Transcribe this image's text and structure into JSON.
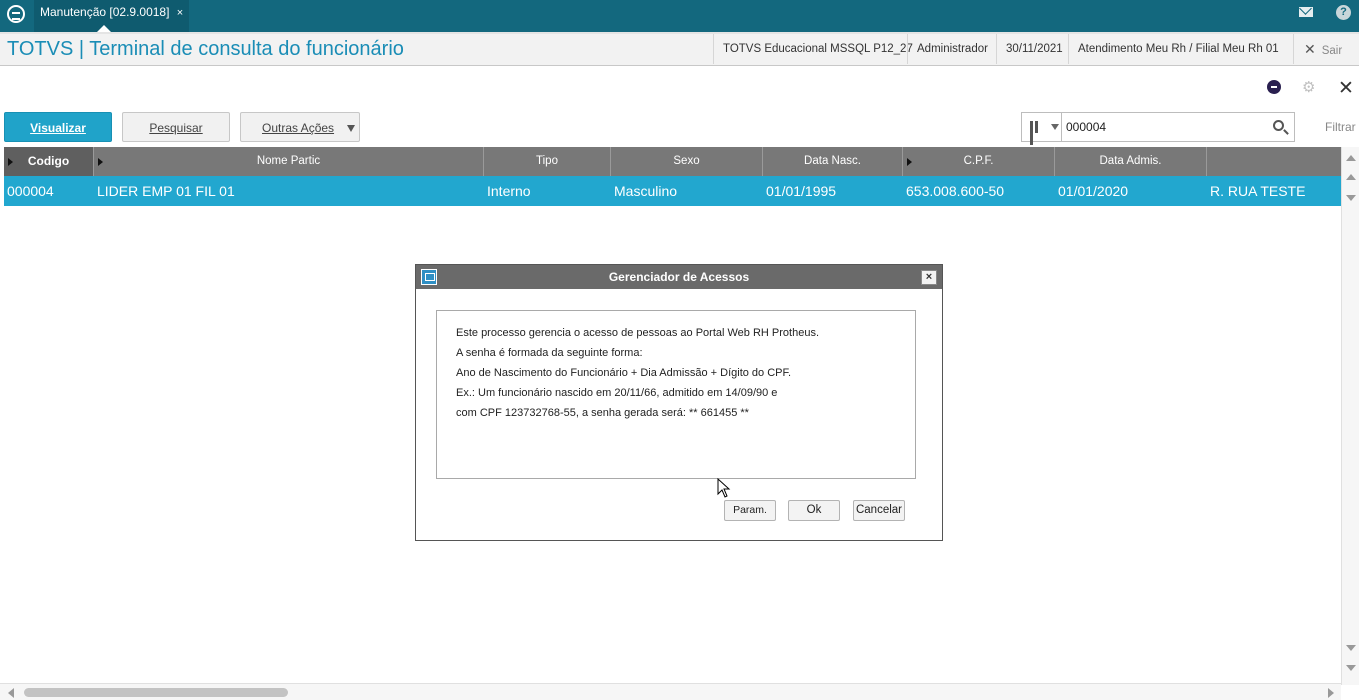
{
  "topbar": {
    "tab_label": "Manutenção [02.9.0018]",
    "tab_close": "×",
    "help": "?"
  },
  "header": {
    "title": "TOTVS | Terminal de consulta do funcionário",
    "environment": "TOTVS Educacional MSSQL P12_27",
    "user": "Administrador",
    "date": "30/11/2021",
    "branch": "Atendimento Meu Rh / Filial Meu Rh 01",
    "exit_label": "Sair",
    "exit_icon": "✕"
  },
  "toolbar": {
    "view_label": "Visualizar",
    "search_label": "Pesquisar",
    "more_actions_label": "Outras Ações",
    "search_value": "000004",
    "filter_label": "Filtrar",
    "close_icon": "✕",
    "gear_icon": "⚙"
  },
  "grid": {
    "columns": [
      "Codigo",
      "Nome  Partic",
      "Tipo",
      "Sexo",
      "Data Nasc.",
      "C.P.F.",
      "Data Admis.",
      ""
    ],
    "rows": [
      [
        "000004",
        "LIDER EMP 01 FIL 01",
        "Interno",
        "Masculino",
        "01/01/1995",
        "653.008.600-50",
        "01/01/2020",
        "R. RUA TESTE"
      ]
    ]
  },
  "dialog": {
    "title": "Gerenciador de Acessos",
    "close": "×",
    "lines": [
      "Este processo gerencia o acesso de pessoas ao Portal Web RH Protheus.",
      "A senha é formada da seguinte forma:",
      "Ano de Nascimento do Funcionário + Dia Admissão + Dígito do CPF.",
      "Ex.: Um funcionário nascido em 20/11/66, admitido em 14/09/90 e",
      "com CPF 123732768-55, a senha gerada será: ** 661455 **"
    ],
    "param_label": "Param.",
    "ok_label": "Ok",
    "cancel_label": "Cancelar"
  },
  "colors": {
    "topbar": "#13687e",
    "title": "#1a8db6",
    "primary_button": "#20a3c9",
    "selected_row": "#22a7cf",
    "grid_header": "#787878"
  }
}
